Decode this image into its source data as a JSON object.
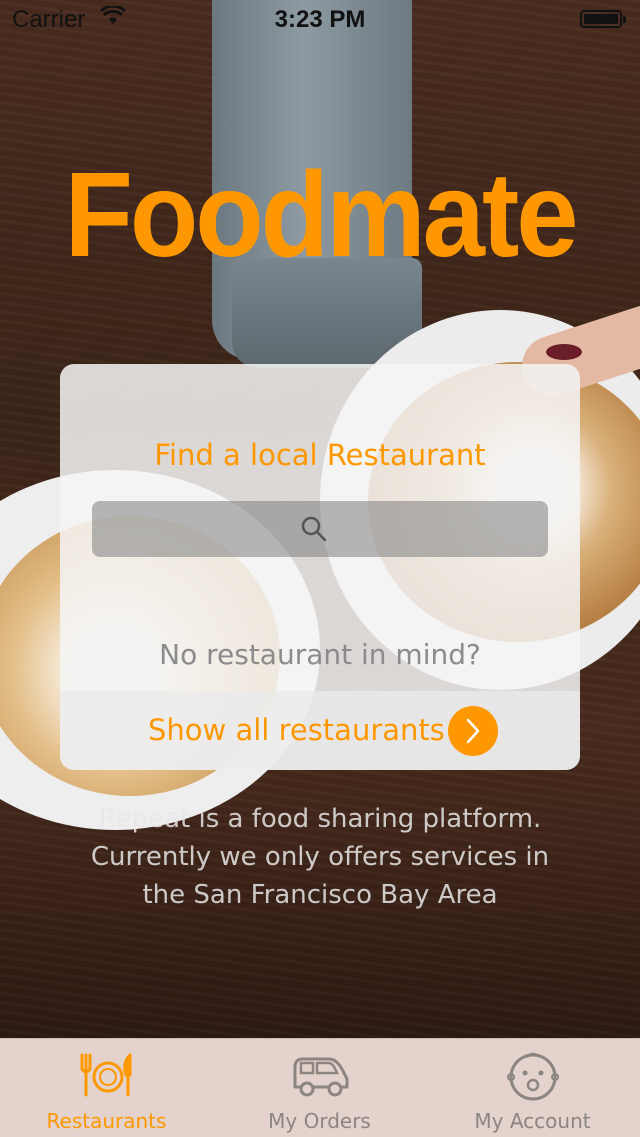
{
  "status_bar": {
    "carrier": "Carrier",
    "time": "3:23 PM",
    "battery_level": 1.0
  },
  "app": {
    "logo": "Foodmate",
    "accent_color": "#ff9800"
  },
  "card": {
    "title": "Find a local Restaurant",
    "search_placeholder": "",
    "no_restaurant_text": "No restaurant in mind?",
    "show_all_label": "Show all restaurants"
  },
  "description": {
    "line1": "Repeat is a food sharing platform.",
    "line2": "Currently we only offers services in",
    "line3": "the San Francisco Bay Area"
  },
  "tabs": [
    {
      "label": "Restaurants",
      "icon": "restaurant-icon",
      "active": true
    },
    {
      "label": "My Orders",
      "icon": "car-icon",
      "active": false
    },
    {
      "label": "My Account",
      "icon": "baby-face-icon",
      "active": false
    }
  ]
}
